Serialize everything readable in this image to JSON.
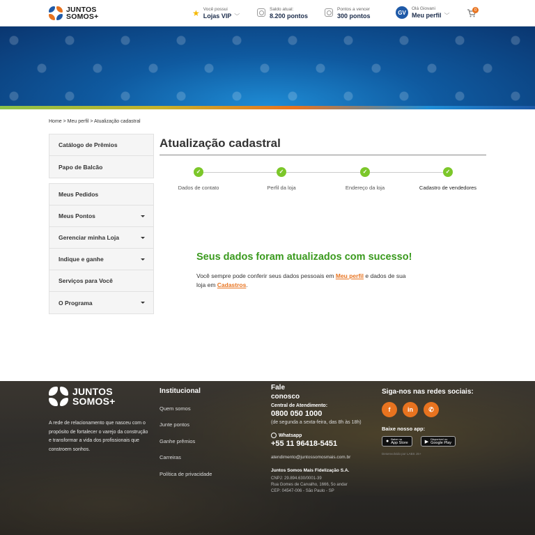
{
  "header": {
    "logo_line1": "JUNTOS",
    "logo_line2": "SOMOS+",
    "vip_small": "Você possui",
    "vip_big": "Lojas VIP",
    "balance_small": "Saldo atual:",
    "balance_big": "8.200 pontos",
    "expire_small": "Pontos a vencer",
    "expire_big": "300 pontos",
    "avatar_initials": "GV",
    "greeting": "Olá Giovani",
    "profile": "Meu perfil",
    "cart_count": "0"
  },
  "breadcrumb": "Home > Meu perfil > Atualização cadastral",
  "sidebar": {
    "group1": [
      {
        "label": "Catálogo de Prêmios",
        "has_caret": false
      },
      {
        "label": "Papo de Balcão",
        "has_caret": false
      }
    ],
    "group2": [
      {
        "label": "Meus Pedidos",
        "has_caret": false
      },
      {
        "label": "Meus Pontos",
        "has_caret": true
      },
      {
        "label": "Gerenciar minha Loja",
        "has_caret": true
      },
      {
        "label": "Indique e ganhe",
        "has_caret": true
      },
      {
        "label": "Serviços para Você",
        "has_caret": false
      },
      {
        "label": "O Programa",
        "has_caret": true
      }
    ]
  },
  "main": {
    "title": "Atualização cadastral",
    "steps": [
      "Dados de contato",
      "Perfil da loja",
      "Endereço da loja",
      "Cadastro de vendedores"
    ],
    "success_title": "Seus dados foram atualizados com sucesso!",
    "text_1": "Você sempre pode conferir seus dados pessoais em ",
    "link_profile": "Meu perfil",
    "text_2": " e dados de sua loja em ",
    "link_cadastros": "Cadastros",
    "text_3": "."
  },
  "footer": {
    "logo_line1": "JUNTOS",
    "logo_line2": "SOMOS+",
    "about": "A rede de relacionamento que nasceu com o propósito de fortalecer o varejo da construção e transformar a vida dos profissionais que constroem sonhos.",
    "inst_title": "Institucional",
    "inst_links": [
      "Quem somos",
      "Junte pontos",
      "Ganhe prêmios",
      "Carreiras",
      "Política de privacidade"
    ],
    "contact_title": "Fale conosco",
    "central_label": "Central de Atendimento:",
    "central_phone": "0800 050 1000",
    "hours": "(de segunda a sexta-feira,  das 8h às 18h)",
    "whatsapp_label": "Whatsapp",
    "whatsapp_phone": "+55 11 96418-5451",
    "email": "atendimento@juntossomosmais.com.br",
    "company": "Juntos Somos Mais Fidelização S.A.",
    "cnpj": "CNPJ: 29.894.630/0001-39",
    "address1": "Rua Gomes de Carvalho, 1666, 5o andar",
    "address2": "CEP: 04547-006 - São Paulo - SP",
    "social_title": "Siga-nos nas redes sociais:",
    "app_title": "Baixe nosso app:",
    "appstore_small": "Baixe na",
    "appstore": "App Store",
    "googleplay_small": "Disponível no",
    "googleplay": "Google Play",
    "dev": "Desenvolvido por LABS JS+"
  },
  "colors": {
    "accent": "#e8731f",
    "brand_blue": "#1f5aa8",
    "success": "#3a9a1e",
    "step": "#7cc72a"
  }
}
